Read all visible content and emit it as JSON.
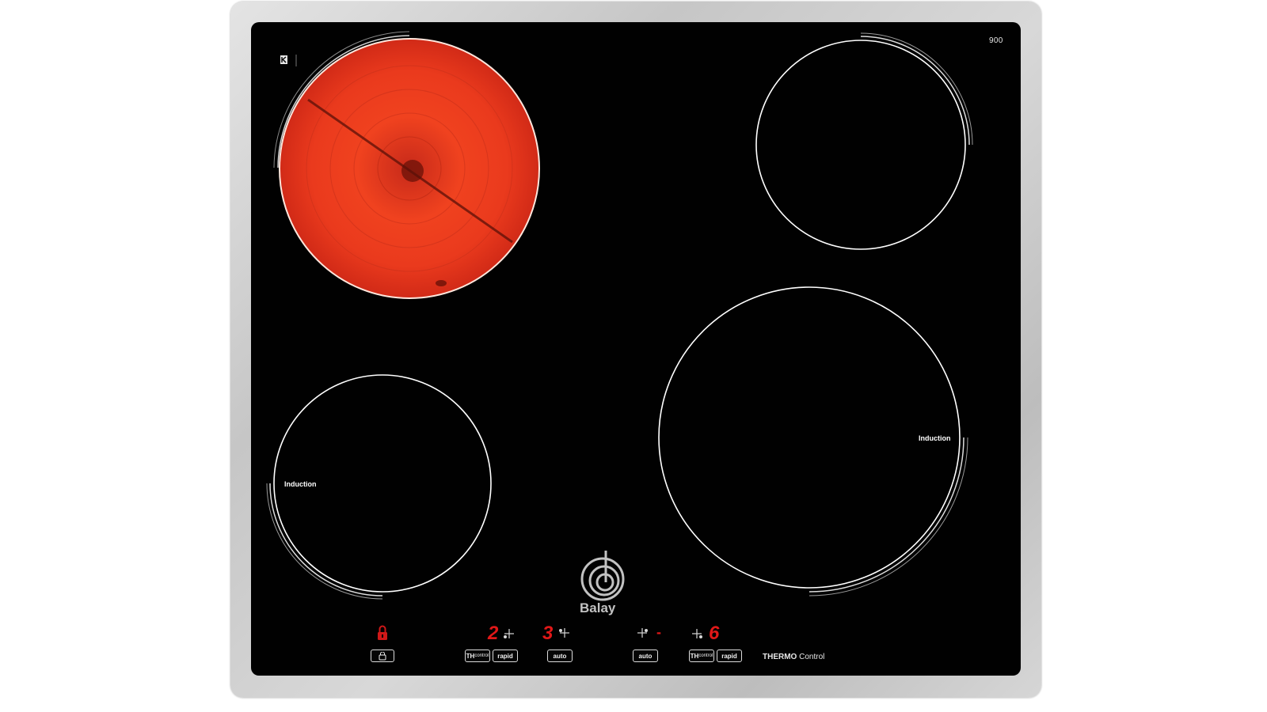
{
  "appliance": {
    "type": "cooktop",
    "model_label": "900",
    "brand": "Balay",
    "icons": {
      "kitchen_badge": "small-k-logo-icon",
      "brand_logo": "balay-spiral-logo-icon",
      "lock_led": "lock-icon",
      "lock_button": "lock-icon",
      "plus_dot": "plus-dot-indicator-icon"
    },
    "colors": {
      "glass": "#010101",
      "frame": "#cfcfcf",
      "hot_zone": "#e8361c",
      "led": "#e01818",
      "outline": "#ffffff"
    }
  },
  "zones": {
    "front_left": {
      "label": "Induction"
    },
    "rear_right_large": {
      "label": "Induction"
    }
  },
  "controls": {
    "displays": {
      "left_level": "2",
      "center_left_level": "3",
      "center_right_level": "-",
      "right_level": "6"
    },
    "buttons": {
      "thcontrol_left_th": "TH",
      "thcontrol_left_ctl": "control",
      "rapid_left": "rapid",
      "auto_left": "auto",
      "auto_right": "auto",
      "thcontrol_right_th": "TH",
      "thcontrol_right_ctl": "control",
      "rapid_right": "rapid"
    },
    "thermo_bold": "THERMO",
    "thermo_rest": " Control"
  }
}
